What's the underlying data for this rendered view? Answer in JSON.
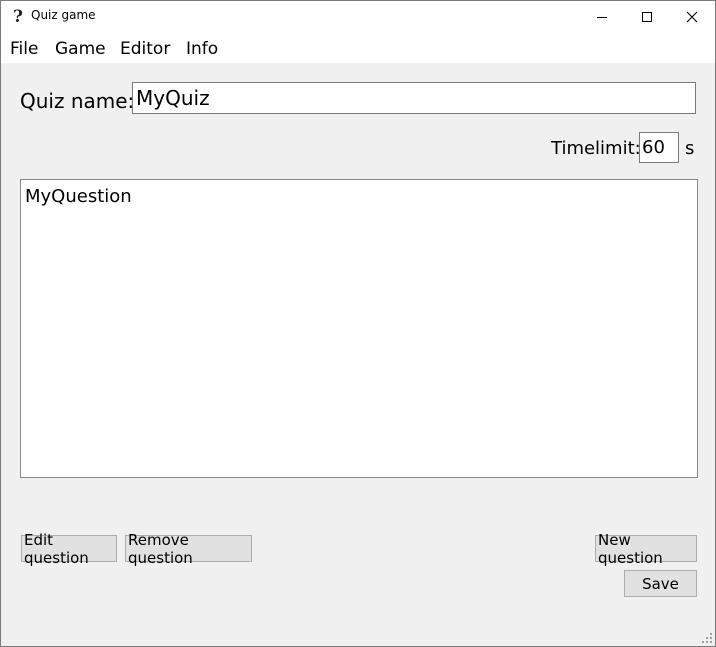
{
  "window": {
    "title": "Quiz game",
    "icon": "question-mark-icon"
  },
  "menu": [
    "File",
    "Game",
    "Editor",
    "Info"
  ],
  "quiz": {
    "name_label": "Quiz name:",
    "name_value": "MyQuiz",
    "timelimit_label": "Timelimit:",
    "timelimit_value": "60",
    "timelimit_unit": "s"
  },
  "questions": [
    "MyQuestion"
  ],
  "buttons": {
    "edit": "Edit question",
    "remove": "Remove question",
    "new": "New question",
    "save": "Save"
  },
  "colors": {
    "window_bg": "#f0f0f0",
    "button_bg": "#e1e1e1",
    "border": "#7a7a7a"
  }
}
